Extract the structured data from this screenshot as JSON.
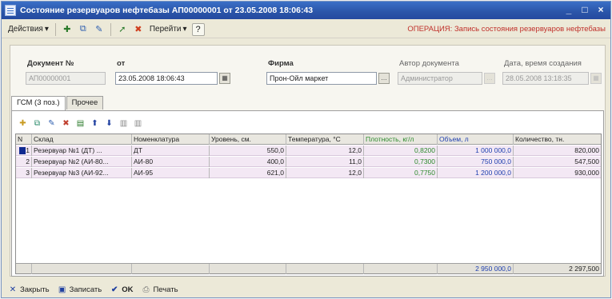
{
  "window": {
    "title": "Состояние резервуаров нефтебазы АП00000001 от 23.05.2008 18:06:43",
    "minimize_glyph": "_",
    "restore_glyph": "□",
    "close_glyph": "×"
  },
  "toolbar": {
    "actions_label": "Действия",
    "goto_label": "Перейти",
    "help_label": "?",
    "operation_text": "ОПЕРАЦИЯ: Запись состояния резервуаров нефтебазы",
    "icons": [
      "add-icon",
      "copy-icon",
      "edit-icon",
      "post-icon",
      "delete-icon"
    ]
  },
  "form": {
    "doc_number_label": "Документ №",
    "doc_number_value": "АП00000001",
    "date_from_label": "от",
    "date_value": "23.05.2008 18:06:43",
    "firm_label": "Фирма",
    "firm_value": "Прон-Ойл маркет",
    "author_label": "Автор документа",
    "author_value": "Администратор",
    "created_label": "Дата, время создания",
    "created_value": "28.05.2008 13:18:35"
  },
  "tabs": [
    {
      "label": "ГСМ (3 поз.)",
      "active": true
    },
    {
      "label": "Прочее",
      "active": false
    }
  ],
  "grid": {
    "columns": [
      "N",
      "Склад",
      "Номенклатура",
      "Уровень, см.",
      "Температура, °С",
      "Плотность, кг/л",
      "Объем, л",
      "Количество, тн."
    ],
    "rows": [
      {
        "n": "1",
        "warehouse": "Резервуар №1 (ДТ) ...",
        "item": "ДТ",
        "level": "550,0",
        "temp": "12,0",
        "density": "0,8200",
        "volume": "1 000 000,0",
        "qty": "820,000"
      },
      {
        "n": "2",
        "warehouse": "Резервуар №2 (АИ-80...",
        "item": "АИ-80",
        "level": "400,0",
        "temp": "11,0",
        "density": "0,7300",
        "volume": "750 000,0",
        "qty": "547,500"
      },
      {
        "n": "3",
        "warehouse": "Резервуар №3 (АИ-92...",
        "item": "АИ-95",
        "level": "621,0",
        "temp": "12,0",
        "density": "0,7750",
        "volume": "1 200 000,0",
        "qty": "930,000"
      }
    ],
    "totals": {
      "volume": "2 950 000,0",
      "qty": "2 297,500"
    }
  },
  "bottom": {
    "close_label": "Закрыть",
    "save_label": "Записать",
    "ok_label": "OK",
    "print_label": "Печать"
  },
  "colors": {
    "title_bar": "#2a55a8",
    "operation_text": "#c0302a",
    "row_highlight": "#f3e8f4",
    "density_header": "#2c8a2c",
    "volume_header": "#2040b0"
  }
}
